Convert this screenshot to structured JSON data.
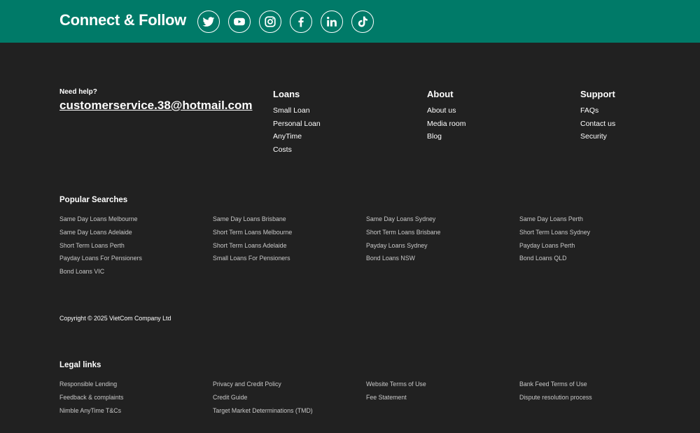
{
  "connect": {
    "title": "Connect & Follow",
    "icons": [
      "twitter-icon",
      "youtube-icon",
      "instagram-icon",
      "facebook-icon",
      "linkedin-icon",
      "tiktok-icon"
    ]
  },
  "help": {
    "label": "Need help?",
    "email": "customerservice.38@hotmail.com"
  },
  "columns": {
    "loans": {
      "title": "Loans",
      "items": [
        "Small Loan",
        "Personal Loan",
        "AnyTime",
        "Costs"
      ]
    },
    "about": {
      "title": "About",
      "items": [
        "About us",
        "Media room",
        "Blog"
      ]
    },
    "support": {
      "title": "Support",
      "items": [
        "FAQs",
        "Contact us",
        "Security"
      ]
    }
  },
  "popular": {
    "title": "Popular Searches",
    "items": [
      "Same Day Loans Melbourne",
      "Same Day Loans Brisbane",
      "Same Day Loans Sydney",
      "Same Day Loans Perth",
      "Same Day Loans Adelaide",
      "Short Term Loans Melbourne",
      "Short Term Loans Brisbane",
      "Short Term Loans Sydney",
      "Short Term Loans Perth",
      "Short Term Loans Adelaide",
      "Payday Loans Sydney",
      "Payday Loans Perth",
      "Payday Loans For Pensioners",
      "Small Loans For Pensioners",
      "Bond Loans NSW",
      "Bond Loans QLD",
      "Bond Loans VIC"
    ]
  },
  "copyright": "Copyright © 2025 VietCom Company Ltd",
  "legal": {
    "title": "Legal links",
    "items": [
      "Responsible Lending",
      "Privacy and Credit Policy",
      "Website Terms of Use",
      "Bank Feed Terms of Use",
      "Feedback & complaints",
      "Credit Guide",
      "Fee Statement",
      "Dispute resolution process",
      "Nimble AnyTime T&Cs",
      "Target Market Determinations (TMD)"
    ]
  },
  "colors": {
    "brand": "#007a68",
    "background": "#212121",
    "muted_link": "#c9c9c9"
  }
}
